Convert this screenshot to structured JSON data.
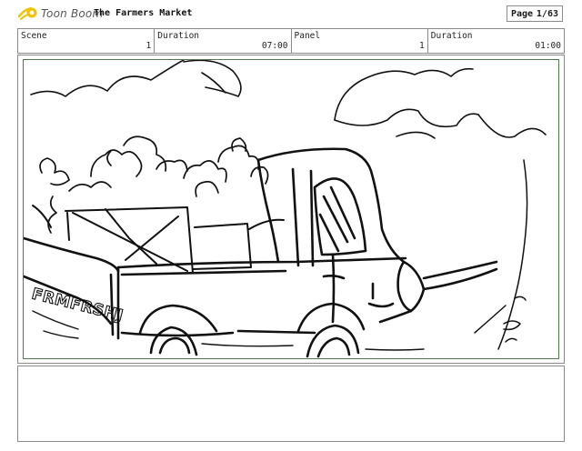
{
  "header": {
    "logo_text": "Toon Boom",
    "project_title": "The Farmers Market",
    "page_label": "Page",
    "page_value": "1/63"
  },
  "info": {
    "scene_label": "Scene",
    "scene_value": "1",
    "duration_label": "Duration",
    "duration_value": "07:00",
    "panel_label": "Panel",
    "panel_value": "1",
    "panel_duration_label": "Duration",
    "panel_duration_value": "01:00"
  },
  "panel": {
    "sketch_text": "FRMFRSHJ"
  },
  "colors": {
    "frame_border": "#8a8a8a",
    "panel_border": "#4e7a4e",
    "logo_yellow": "#f2c200"
  },
  "icons": [
    "toon-boom-logo-icon"
  ]
}
